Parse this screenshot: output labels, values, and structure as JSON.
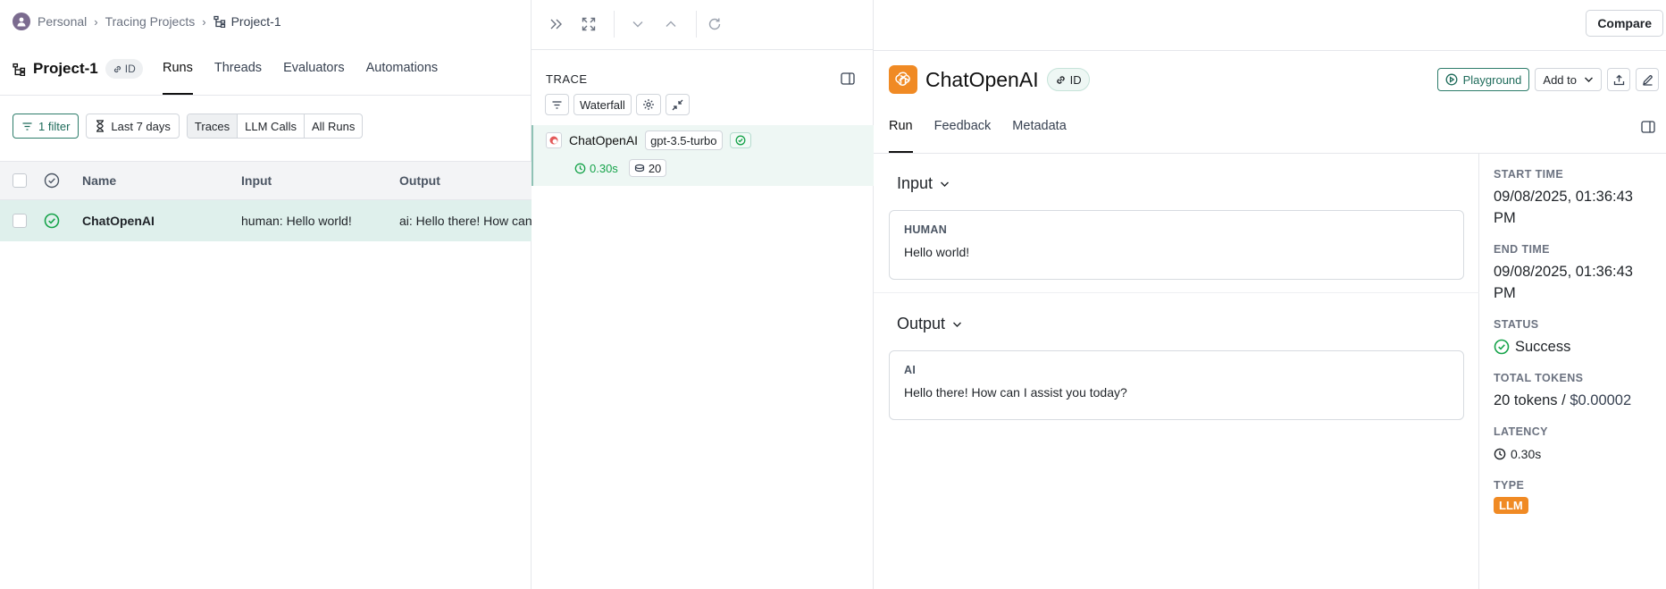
{
  "breadcrumb": {
    "workspace": "Personal",
    "section": "Tracing Projects",
    "project": "Project-1"
  },
  "project": {
    "title": "Project-1",
    "id_label": "ID",
    "tabs": [
      "Runs",
      "Threads",
      "Evaluators",
      "Automations"
    ],
    "active_tab": "Runs"
  },
  "filters": {
    "filter_label": "1 filter",
    "date_range": "Last 7 days",
    "run_types": [
      "Traces",
      "LLM Calls",
      "All Runs"
    ],
    "selected_run_type": "Traces"
  },
  "table": {
    "columns": [
      "Name",
      "Input",
      "Output"
    ],
    "rows": [
      {
        "name": "ChatOpenAI",
        "input": "human: Hello world!",
        "output": "ai: Hello there! How can I assist you today?"
      }
    ]
  },
  "trace": {
    "label": "TRACE",
    "view_mode": "Waterfall",
    "items": [
      {
        "name": "ChatOpenAI",
        "model": "gpt-3.5-turbo",
        "latency": "0.30s",
        "tokens": "20"
      }
    ]
  },
  "run": {
    "title": "ChatOpenAI",
    "id_label": "ID",
    "compare_label": "Compare",
    "playground_label": "Playground",
    "add_to_label": "Add to",
    "tabs": [
      "Run",
      "Feedback",
      "Metadata"
    ],
    "active_tab": "Run",
    "input": {
      "section_title": "Input",
      "role": "HUMAN",
      "text": "Hello world!"
    },
    "output": {
      "section_title": "Output",
      "role": "AI",
      "text": "Hello there! How can I assist you today?"
    }
  },
  "metadata": {
    "start_time_label": "START TIME",
    "start_time": "09/08/2025, 01:36:43 PM",
    "end_time_label": "END TIME",
    "end_time": "09/08/2025, 01:36:43 PM",
    "status_label": "STATUS",
    "status": "Success",
    "total_tokens_label": "TOTAL TOKENS",
    "total_tokens": "20 tokens",
    "total_cost": "$0.00002",
    "latency_label": "LATENCY",
    "latency": "0.30s",
    "type_label": "TYPE",
    "type": "LLM"
  },
  "colors": {
    "accent_green": "#2e7d6b",
    "selected_row": "#dff0ec",
    "openai_orange": "#f08a24",
    "success_green": "#16a34a"
  }
}
